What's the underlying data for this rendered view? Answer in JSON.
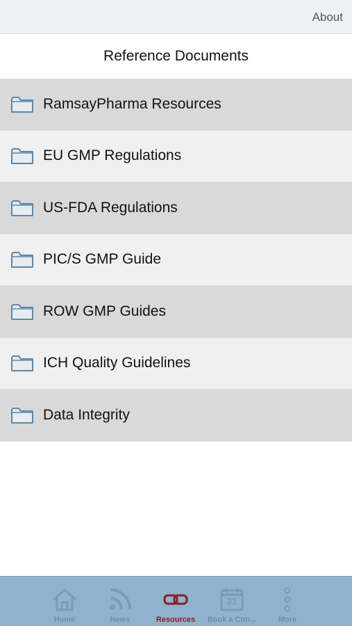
{
  "header": {
    "about_label": "About"
  },
  "page": {
    "title": "Reference Documents"
  },
  "documents": [
    {
      "label": "RamsayPharma Resources"
    },
    {
      "label": "EU GMP Regulations"
    },
    {
      "label": "US-FDA Regulations"
    },
    {
      "label": "PIC/S GMP Guide"
    },
    {
      "label": "ROW GMP Guides"
    },
    {
      "label": "ICH Quality Guidelines"
    },
    {
      "label": "Data Integrity"
    }
  ],
  "tabbar": {
    "items": [
      {
        "label": "Home",
        "icon": "home-icon",
        "active": false
      },
      {
        "label": "News",
        "icon": "rss-icon",
        "active": false
      },
      {
        "label": "Resources",
        "icon": "link-icon",
        "active": true
      },
      {
        "label": "Book a Con...",
        "icon": "calendar-icon",
        "calendar_day": "31",
        "active": false
      },
      {
        "label": "More",
        "icon": "more-icon",
        "active": false
      }
    ]
  },
  "colors": {
    "tabbar_bg": "#8fb3cc",
    "active_tab": "#8a1c28",
    "folder_stroke": "#5f87a6"
  }
}
